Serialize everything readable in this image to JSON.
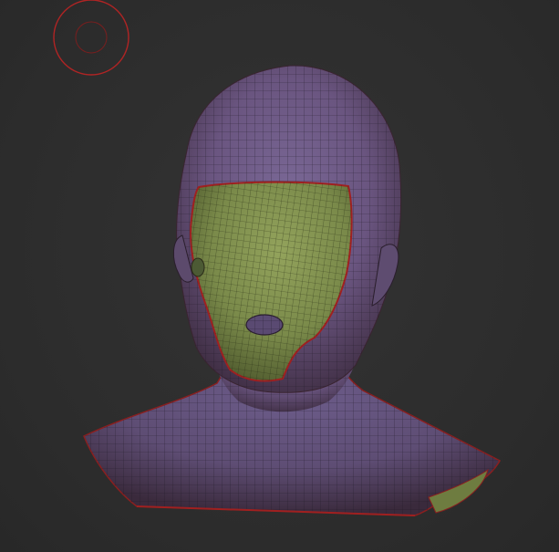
{
  "app": {
    "canvas_background": "#2e2e2e"
  },
  "brush_cursor": {
    "icon": "brush-cursor-icon",
    "color": "#b02424"
  },
  "model": {
    "name_visible": false,
    "polyframe_visible": true,
    "colors": {
      "skin": "#6f5a8a",
      "skin_shadow": "#3a2a3a",
      "masked_face": "#7e8f4e",
      "wire": "#1f1a24",
      "border_seam": "#a02020"
    }
  }
}
